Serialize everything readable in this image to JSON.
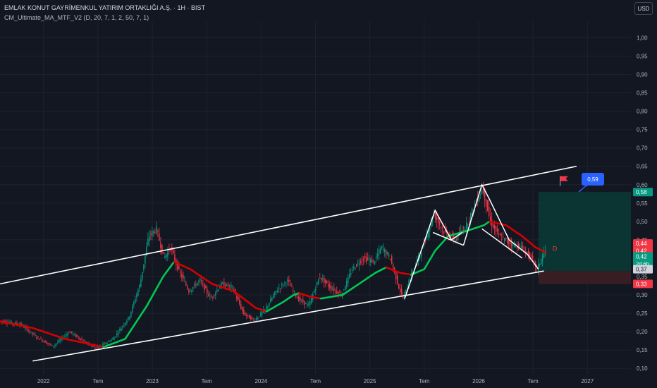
{
  "header": {
    "symbol_title": "EMLAK KONUT GAYRİMENKUL YATIRIM ORTAKLIĞI A.Ş. · 1H · BIST",
    "indicator": "CM_Ultimate_MA_MTF_V2 (D, 20, 7, 1, 2, 50, 7, 1)",
    "currency": "USD"
  },
  "colors": {
    "background": "#131722",
    "grid": "#1e222d",
    "up": "#089981",
    "down": "#f23645",
    "ma_up": "#00c853",
    "ma_down": "#d50000",
    "channel": "#ffffff",
    "axis_text": "#b2b5be",
    "target_zone": "#0b3b36",
    "stop_zone": "#3d1f24",
    "callout": "#2962ff"
  },
  "chart_data": {
    "type": "candlestick",
    "x_axis": {
      "range": [
        2021.6,
        2027.4
      ],
      "ticks": [
        {
          "x": 2022.0,
          "label": "2022"
        },
        {
          "x": 2022.5,
          "label": "Tem"
        },
        {
          "x": 2023.0,
          "label": "2023"
        },
        {
          "x": 2023.5,
          "label": "Tem"
        },
        {
          "x": 2024.0,
          "label": "2024"
        },
        {
          "x": 2024.5,
          "label": "Tem"
        },
        {
          "x": 2025.0,
          "label": "2025"
        },
        {
          "x": 2025.5,
          "label": "Tem"
        },
        {
          "x": 2026.0,
          "label": "2026"
        },
        {
          "x": 2026.5,
          "label": "Tem"
        },
        {
          "x": 2027.0,
          "label": "2027"
        }
      ]
    },
    "y_axis": {
      "range": [
        0.085,
        1.045
      ],
      "ticks": [
        {
          "y": 0.1,
          "label": "0,10"
        },
        {
          "y": 0.15,
          "label": "0,15"
        },
        {
          "y": 0.2,
          "label": "0,20"
        },
        {
          "y": 0.25,
          "label": "0,25"
        },
        {
          "y": 0.3,
          "label": "0,30"
        },
        {
          "y": 0.35,
          "label": "0,35"
        },
        {
          "y": 0.4,
          "label": "0,40"
        },
        {
          "y": 0.45,
          "label": "0,45"
        },
        {
          "y": 0.5,
          "label": "0,50"
        },
        {
          "y": 0.55,
          "label": "0,55"
        },
        {
          "y": 0.6,
          "label": "0,60"
        },
        {
          "y": 0.65,
          "label": "0,65"
        },
        {
          "y": 0.7,
          "label": "0,70"
        },
        {
          "y": 0.75,
          "label": "0,75"
        },
        {
          "y": 0.8,
          "label": "0,80"
        },
        {
          "y": 0.85,
          "label": "0,85"
        },
        {
          "y": 0.9,
          "label": "0,90"
        },
        {
          "y": 0.95,
          "label": "0,95"
        },
        {
          "y": 1.0,
          "label": "1,00"
        }
      ]
    },
    "price_path": [
      [
        2021.6,
        0.23
      ],
      [
        2021.8,
        0.22
      ],
      [
        2021.95,
        0.185
      ],
      [
        2022.1,
        0.16
      ],
      [
        2022.25,
        0.2
      ],
      [
        2022.4,
        0.17
      ],
      [
        2022.5,
        0.155
      ],
      [
        2022.65,
        0.18
      ],
      [
        2022.8,
        0.24
      ],
      [
        2022.9,
        0.33
      ],
      [
        2022.98,
        0.46
      ],
      [
        2023.05,
        0.48
      ],
      [
        2023.12,
        0.4
      ],
      [
        2023.18,
        0.43
      ],
      [
        2023.25,
        0.37
      ],
      [
        2023.35,
        0.31
      ],
      [
        2023.45,
        0.34
      ],
      [
        2023.55,
        0.29
      ],
      [
        2023.65,
        0.33
      ],
      [
        2023.75,
        0.32
      ],
      [
        2023.85,
        0.25
      ],
      [
        2023.95,
        0.23
      ],
      [
        2024.05,
        0.26
      ],
      [
        2024.15,
        0.31
      ],
      [
        2024.25,
        0.34
      ],
      [
        2024.35,
        0.29
      ],
      [
        2024.45,
        0.27
      ],
      [
        2024.55,
        0.35
      ],
      [
        2024.65,
        0.32
      ],
      [
        2024.75,
        0.3
      ],
      [
        2024.85,
        0.37
      ],
      [
        2024.95,
        0.4
      ],
      [
        2025.05,
        0.39
      ],
      [
        2025.12,
        0.43
      ],
      [
        2025.2,
        0.4
      ],
      [
        2025.28,
        0.32
      ],
      [
        2025.32,
        0.29
      ],
      [
        2025.4,
        0.36
      ],
      [
        2025.5,
        0.43
      ],
      [
        2025.6,
        0.52
      ],
      [
        2025.7,
        0.47
      ],
      [
        2025.8,
        0.45
      ],
      [
        2025.9,
        0.49
      ],
      [
        2026.0,
        0.56
      ],
      [
        2026.05,
        0.59
      ],
      [
        2026.12,
        0.5
      ],
      [
        2026.2,
        0.46
      ],
      [
        2026.3,
        0.44
      ],
      [
        2026.4,
        0.43
      ],
      [
        2026.5,
        0.4
      ],
      [
        2026.55,
        0.37
      ],
      [
        2026.62,
        0.42
      ]
    ],
    "series": [
      {
        "type": "moving_average",
        "segments": [
          {
            "color": "down",
            "points": [
              [
                2021.6,
                0.228
              ],
              [
                2021.9,
                0.21
              ],
              [
                2022.2,
                0.18
              ],
              [
                2022.4,
                0.168
              ],
              [
                2022.55,
                0.158
              ]
            ]
          },
          {
            "color": "up",
            "points": [
              [
                2022.55,
                0.158
              ],
              [
                2022.75,
                0.18
              ],
              [
                2022.95,
                0.27
              ],
              [
                2023.1,
                0.35
              ],
              [
                2023.2,
                0.39
              ]
            ]
          },
          {
            "color": "down",
            "points": [
              [
                2023.2,
                0.39
              ],
              [
                2023.35,
                0.37
              ],
              [
                2023.55,
                0.33
              ],
              [
                2023.75,
                0.31
              ],
              [
                2023.95,
                0.265
              ],
              [
                2024.05,
                0.255
              ]
            ]
          },
          {
            "color": "up",
            "points": [
              [
                2024.05,
                0.255
              ],
              [
                2024.2,
                0.28
              ],
              [
                2024.3,
                0.3
              ],
              [
                2024.35,
                0.305
              ]
            ]
          },
          {
            "color": "down",
            "points": [
              [
                2024.35,
                0.305
              ],
              [
                2024.45,
                0.295
              ],
              [
                2024.55,
                0.29
              ]
            ]
          },
          {
            "color": "up",
            "points": [
              [
                2024.55,
                0.29
              ],
              [
                2024.75,
                0.3
              ],
              [
                2024.9,
                0.33
              ],
              [
                2025.05,
                0.36
              ],
              [
                2025.15,
                0.375
              ]
            ]
          },
          {
            "color": "down",
            "points": [
              [
                2025.15,
                0.375
              ],
              [
                2025.28,
                0.36
              ],
              [
                2025.38,
                0.355
              ]
            ]
          },
          {
            "color": "up",
            "points": [
              [
                2025.38,
                0.355
              ],
              [
                2025.5,
                0.37
              ],
              [
                2025.6,
                0.42
              ],
              [
                2025.72,
                0.46
              ],
              [
                2025.9,
                0.475
              ],
              [
                2026.05,
                0.49
              ],
              [
                2026.1,
                0.5
              ]
            ]
          },
          {
            "color": "down",
            "points": [
              [
                2026.1,
                0.5
              ],
              [
                2026.25,
                0.49
              ],
              [
                2026.4,
                0.46
              ],
              [
                2026.52,
                0.43
              ],
              [
                2026.62,
                0.415
              ]
            ]
          }
        ]
      }
    ],
    "channel_lines": [
      [
        [
          2021.6,
          0.33
        ],
        [
          2026.9,
          0.65
        ]
      ],
      [
        [
          2021.9,
          0.12
        ],
        [
          2026.6,
          0.365
        ]
      ]
    ],
    "pattern_lines": [
      [
        [
          2025.32,
          0.29
        ],
        [
          2025.6,
          0.53
        ],
        [
          2025.75,
          0.45
        ],
        [
          2025.85,
          0.47
        ]
      ],
      [
        [
          2025.58,
          0.47
        ],
        [
          2025.86,
          0.435
        ]
      ],
      [
        [
          2025.86,
          0.435
        ],
        [
          2026.03,
          0.6
        ],
        [
          2026.1,
          0.56
        ],
        [
          2026.28,
          0.45
        ],
        [
          2026.45,
          0.41
        ],
        [
          2026.55,
          0.37
        ]
      ],
      [
        [
          2026.03,
          0.48
        ],
        [
          2026.4,
          0.4
        ]
      ]
    ],
    "target_zone": {
      "x": [
        2026.55,
        2027.4
      ],
      "y": [
        0.365,
        0.58
      ]
    },
    "stop_zone": {
      "x": [
        2026.55,
        2027.4
      ],
      "y": [
        0.33,
        0.365
      ]
    },
    "flag": {
      "x": 2026.75,
      "y": 0.6
    },
    "signal_marker": {
      "x": 2026.68,
      "y": 0.42,
      "label": "D"
    },
    "callout": {
      "x": 2027.05,
      "y": 0.615,
      "label": "0,59",
      "anchor": {
        "x": 2026.92,
        "y": 0.58
      }
    },
    "price_labels": [
      {
        "y": 0.58,
        "label": "0,58",
        "color": "up"
      },
      {
        "y": 0.44,
        "label": "0,44",
        "color": "down"
      },
      {
        "y": 0.42,
        "label": "0,42",
        "color": "down",
        "detail": ""
      },
      {
        "y": 0.405,
        "label": "0,42",
        "color": "up",
        "detail": "2d 6h"
      },
      {
        "y": 0.37,
        "label": "0,37",
        "color": "neutral"
      },
      {
        "y": 0.33,
        "label": "0,33",
        "color": "down"
      }
    ]
  }
}
